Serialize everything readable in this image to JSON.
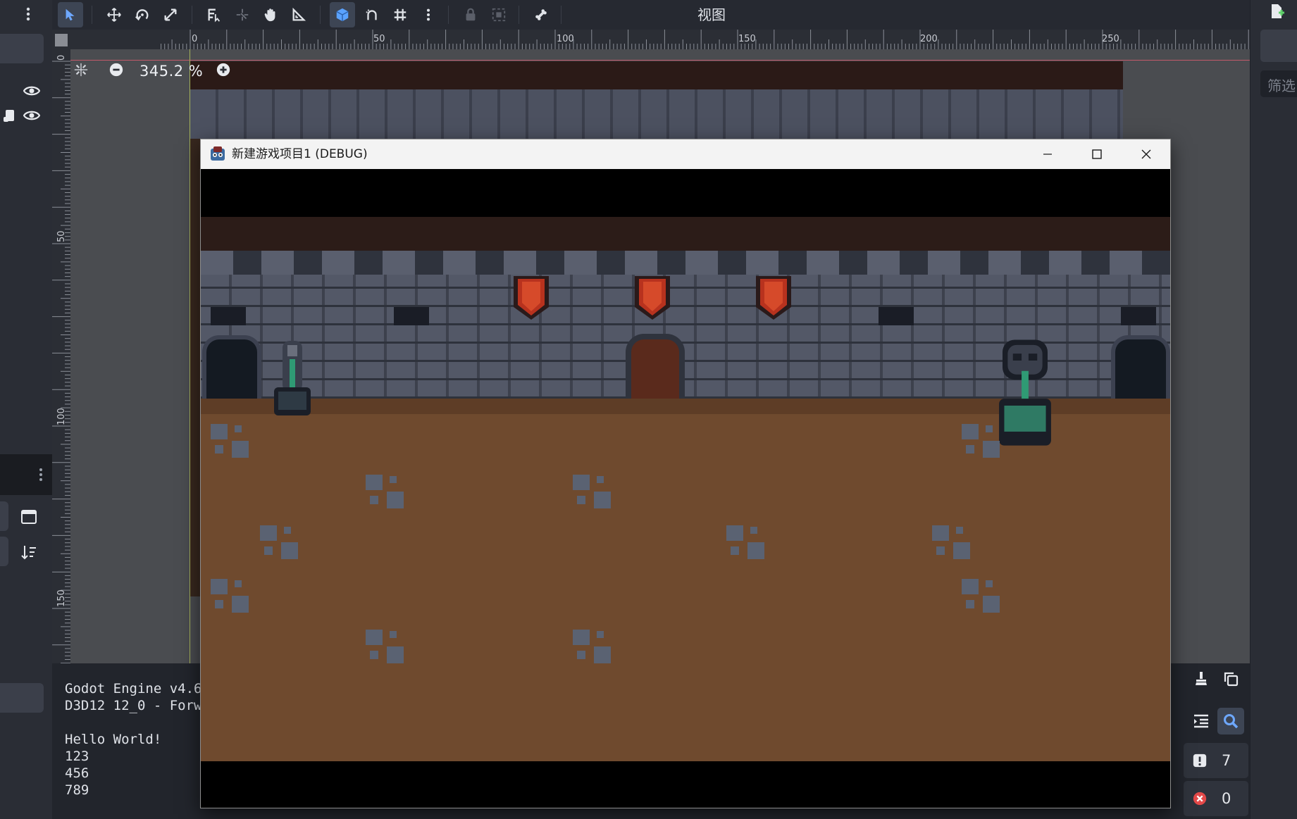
{
  "toolbar": {
    "view_menu_label": "视图",
    "tools": [
      "more-vertical-icon",
      "select-icon",
      "move-icon",
      "rotate-icon",
      "scale-icon",
      "selectable-list-icon",
      "pivot-icon",
      "pan-icon",
      "ruler-icon",
      "smart-snap-icon",
      "snap-icon",
      "grid-icon",
      "more-vertical-icon",
      "lock-icon",
      "group-icon",
      "bone-icon"
    ],
    "active_tool": "select-icon",
    "active_snap": "smart-snap-icon"
  },
  "viewport": {
    "zoom_value": "345.2 %",
    "ruler_h_labels": [
      "0",
      "50",
      "100",
      "150",
      "200",
      "250"
    ],
    "ruler_v_labels": [
      "0",
      "50",
      "100",
      "150"
    ]
  },
  "right_dock": {
    "filter_placeholder": "筛选"
  },
  "output": {
    "lines": [
      "Godot Engine v4.6",
      "D3D12 12_0 - Forw",
      "",
      "Hello World!",
      "123",
      "456",
      "789"
    ],
    "warning_count": "7",
    "error_count": "0"
  },
  "game_window": {
    "title": "新建游戏项目1 (DEBUG)"
  },
  "colors": {
    "editor_bg": "#1f2229",
    "accent": "#4a90e2",
    "floor": "#6f4a2e",
    "wall": "#535867",
    "banner": "#b8321e"
  }
}
